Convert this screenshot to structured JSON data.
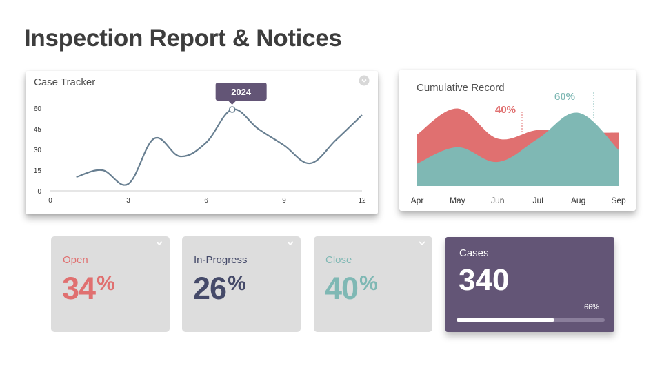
{
  "title": "Inspection Report & Notices",
  "chart_data": [
    {
      "type": "line",
      "title": "Case Tracker",
      "x": [
        1,
        2,
        3,
        4,
        5,
        6,
        7,
        8,
        9,
        10,
        11,
        12
      ],
      "values": [
        10,
        15,
        5,
        38,
        25,
        35,
        59,
        45,
        33,
        20,
        37,
        55
      ],
      "x_ticks": [
        0,
        3,
        6,
        9,
        12
      ],
      "y_ticks": [
        0,
        15,
        30,
        45,
        60
      ],
      "xlim": [
        0,
        12
      ],
      "ylim": [
        0,
        60
      ],
      "highlight": {
        "x": 7,
        "label": "2024"
      },
      "line_color": "#687f91",
      "tooltip_color": "#635576"
    },
    {
      "type": "area",
      "title": "Cumulative Record",
      "categories": [
        "Apr",
        "May",
        "Jun",
        "Jul",
        "Aug",
        "Sep"
      ],
      "series": [
        {
          "values": [
            60,
            90,
            55,
            65,
            62,
            62
          ],
          "color": "#e07070",
          "annotation": "40%"
        },
        {
          "values": [
            26,
            45,
            28,
            55,
            85,
            42
          ],
          "color": "#7fb8b4",
          "annotation": "60%"
        }
      ],
      "ylim": [
        0,
        100
      ],
      "grid": false
    }
  ],
  "tiles": [
    {
      "label": "Open",
      "value": "34",
      "suffix": "%",
      "color": "#e07070"
    },
    {
      "label": "In-Progress",
      "value": "26",
      "suffix": "%",
      "color": "#454a69"
    },
    {
      "label": "Close",
      "value": "40",
      "suffix": "%",
      "color": "#7fb8b4"
    }
  ],
  "cases": {
    "label": "Cases",
    "value": "340",
    "progress_label": "66%",
    "progress": 0.66
  }
}
